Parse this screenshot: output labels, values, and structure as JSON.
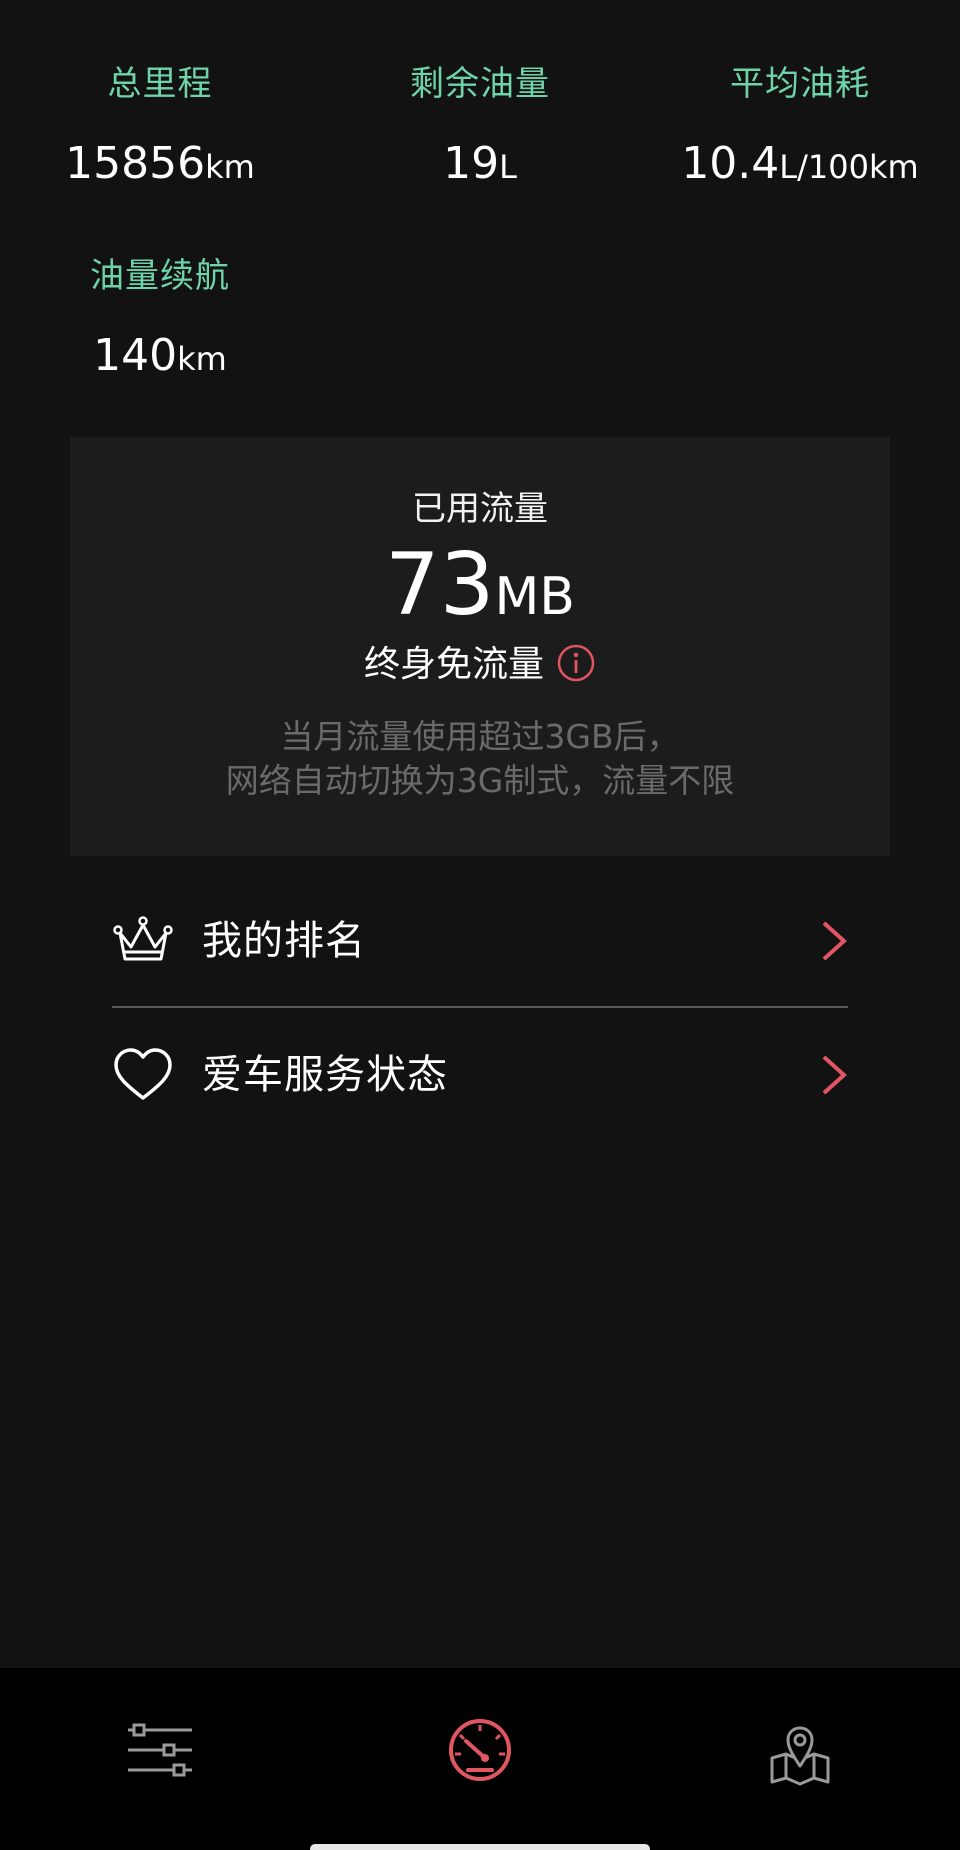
{
  "colors": {
    "background": "#121212",
    "card": "#1c1c1c",
    "label_green": "#6fd3a8",
    "accent_red": "#e25563",
    "muted_text": "#6a6a6a",
    "tab_bar": "#000000",
    "inactive_icon": "#9a9a9a"
  },
  "stats": [
    {
      "label": "总里程",
      "value": "15856",
      "unit": "km"
    },
    {
      "label": "剩余油量",
      "value": "19",
      "unit": "L"
    },
    {
      "label": "平均油耗",
      "value": "10.4",
      "unit": "L/100km"
    },
    {
      "label": "油量续航",
      "value": "140",
      "unit": "km"
    }
  ],
  "data_usage": {
    "title": "已用流量",
    "value": "73",
    "unit": "MB",
    "plan": "终身免流量",
    "info_icon": "info-icon",
    "note_line1": "当月流量使用超过3GB后，",
    "note_line2": "网络自动切换为3G制式，流量不限"
  },
  "menu": [
    {
      "label": "我的排名",
      "icon": "crown-icon"
    },
    {
      "label": "爱车服务状态",
      "icon": "heart-icon"
    }
  ],
  "tabs": [
    {
      "icon": "sliders-icon",
      "active": false
    },
    {
      "icon": "speedometer-icon",
      "active": true
    },
    {
      "icon": "map-pin-icon",
      "active": false
    }
  ]
}
